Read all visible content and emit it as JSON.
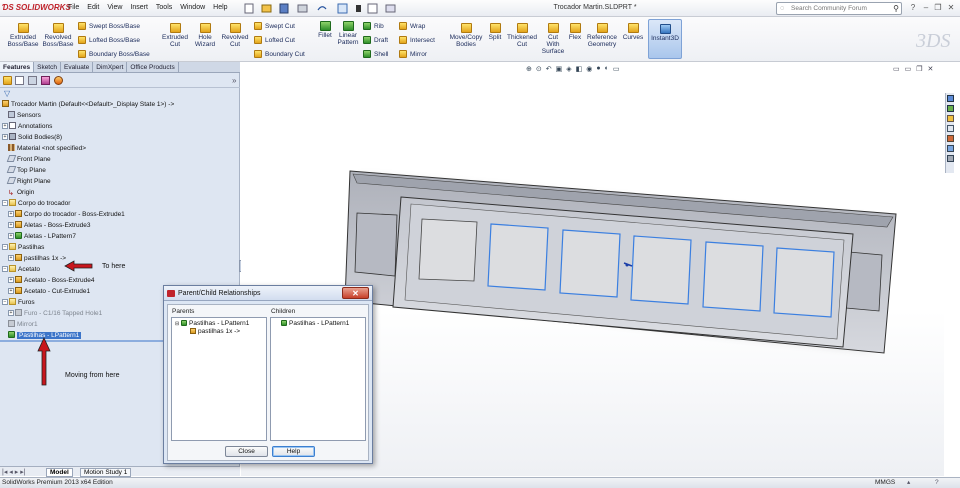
{
  "app": {
    "logo_text": "SOLIDWORKS",
    "menus": [
      "File",
      "Edit",
      "View",
      "Insert",
      "Tools",
      "Window",
      "Help"
    ],
    "document_title": "Trocador Martin.SLDPRT *",
    "search_placeholder": "Search Community Forum"
  },
  "command_manager": {
    "big_tools": [
      {
        "label1": "Extruded",
        "label2": "Boss/Base"
      },
      {
        "label1": "Revolved",
        "label2": "Boss/Base"
      },
      {
        "label1": "Extruded",
        "label2": "Cut"
      },
      {
        "label1": "Hole",
        "label2": "Wizard"
      },
      {
        "label1": "Revolved",
        "label2": "Cut"
      },
      {
        "label1": "Fillet",
        "label2": ""
      },
      {
        "label1": "Linear",
        "label2": "Pattern"
      },
      {
        "label1": "Move/Copy",
        "label2": "Bodies"
      },
      {
        "label1": "Split",
        "label2": ""
      },
      {
        "label1": "Thickened",
        "label2": "Cut"
      },
      {
        "label1": "Cut",
        "label2": "With"
      },
      {
        "label1": "Flex",
        "label2": ""
      },
      {
        "label1": "Reference",
        "label2": "Geometry"
      },
      {
        "label1": "Curves",
        "label2": ""
      },
      {
        "label1": "Instant3D",
        "label2": ""
      }
    ],
    "cut_with_surface_line3": "Surface",
    "small_tools": {
      "swept_boss": "Swept Boss/Base",
      "lofted_boss": "Lofted Boss/Base",
      "boundary_boss": "Boundary Boss/Base",
      "swept_cut": "Swept Cut",
      "lofted_cut": "Lofted Cut",
      "boundary_cut": "Boundary Cut",
      "rib": "Rib",
      "draft": "Draft",
      "shell": "Shell",
      "wrap": "Wrap",
      "intersect": "Intersect",
      "mirror": "Mirror"
    }
  },
  "feature_manager": {
    "tabs": [
      "Features",
      "Sketch",
      "Evaluate",
      "DimXpert",
      "Office Products"
    ],
    "tree": [
      {
        "label": "Trocador Martin  (Default<<Default>_Display State 1>) ->"
      },
      {
        "label": "Sensors"
      },
      {
        "label": "Annotations"
      },
      {
        "label": "Solid Bodies(8)"
      },
      {
        "label": "Material <not specified>"
      },
      {
        "label": "Front Plane"
      },
      {
        "label": "Top Plane"
      },
      {
        "label": "Right Plane"
      },
      {
        "label": "Origin"
      },
      {
        "label": "Corpo do trocador"
      },
      {
        "label": "Corpo do trocador - Boss-Extrude1"
      },
      {
        "label": "Aletas - Boss-Extrude3"
      },
      {
        "label": "Aletas - LPattern7"
      },
      {
        "label": "Pastilhas"
      },
      {
        "label": "pastilhas 1x ->"
      },
      {
        "label": "Acetato"
      },
      {
        "label": "Acetato - Boss-Extrude4"
      },
      {
        "label": "Acetato - Cut-Extrude1"
      },
      {
        "label": "Furos"
      },
      {
        "label": "Furo - C1/16 Tapped Hole1"
      },
      {
        "label": "Mirror1"
      },
      {
        "label": "Pastilhas - LPattern1"
      }
    ],
    "annotation_to_here": "To here",
    "annotation_moving": "Moving from here",
    "bottom_tabs": [
      "Model",
      "Motion Study 1"
    ]
  },
  "dialog": {
    "title": "Parent/Child Relationships",
    "parents_label": "Parents",
    "children_label": "Children",
    "parents": [
      "Pastilhas - LPattern1",
      "pastilhas 1x ->"
    ],
    "children": [
      "Pastilhas - LPattern1"
    ],
    "close_button": "Close",
    "help_button": "Help"
  },
  "status": {
    "edition": "SolidWorks Premium 2013 x64 Edition",
    "units": "MMGS"
  },
  "colors": {
    "selection": "#3b74c9",
    "panel_bg": "#dee6f2",
    "annotation_arrow": "#c8161d",
    "model_body": "#c9cbd3",
    "pad_outline": "#3b7fe0"
  }
}
